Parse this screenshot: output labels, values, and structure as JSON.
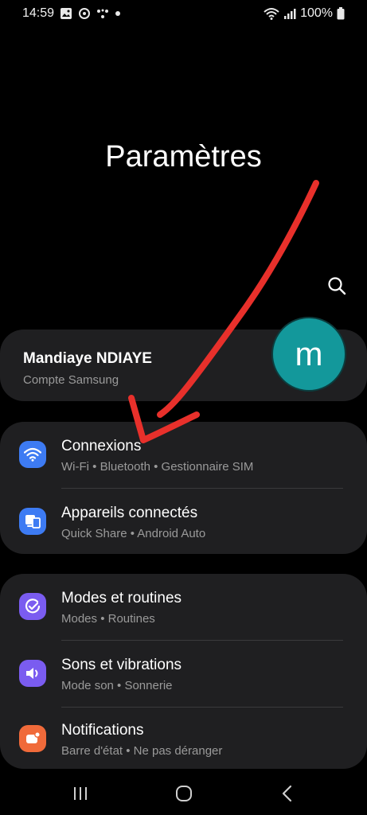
{
  "status_bar": {
    "time": "14:59",
    "battery": "100%",
    "left_icons": [
      "gallery-icon",
      "sync-icon",
      "dots-app-icon",
      "notification-dot-icon"
    ],
    "right_icons": [
      "wifi-icon",
      "signal-icon",
      "battery-icon"
    ]
  },
  "page": {
    "title": "Paramètres"
  },
  "account": {
    "name": "Mandiaye NDIAYE",
    "subtitle": "Compte Samsung",
    "avatar_letter": "m",
    "avatar_color": "#13989b"
  },
  "groups": [
    {
      "items": [
        {
          "title": "Connexions",
          "subtitle": "Wi-Fi  •  Bluetooth  •  Gestionnaire SIM",
          "icon": "wifi-icon",
          "color": "#3d7bf3"
        },
        {
          "title": "Appareils connectés",
          "subtitle": "Quick Share  •  Android Auto",
          "icon": "connected-devices-icon",
          "color": "#3d7bf3"
        }
      ]
    },
    {
      "items": [
        {
          "title": "Modes et routines",
          "subtitle": "Modes  •  Routines",
          "icon": "modes-check-icon",
          "color": "#7a5cf0"
        },
        {
          "title": "Sons et vibrations",
          "subtitle": "Mode son  •  Sonnerie",
          "icon": "speaker-icon",
          "color": "#7a5cf0"
        },
        {
          "title": "Notifications",
          "subtitle": "Barre d'état  •  Ne pas déranger",
          "icon": "notifications-icon",
          "color": "#f06a3a"
        }
      ]
    }
  ],
  "annotation": {
    "color": "#e8302b",
    "type": "hand-drawn-arrow"
  },
  "navbar": {
    "icons": [
      "recents-icon",
      "home-icon",
      "back-icon"
    ]
  }
}
